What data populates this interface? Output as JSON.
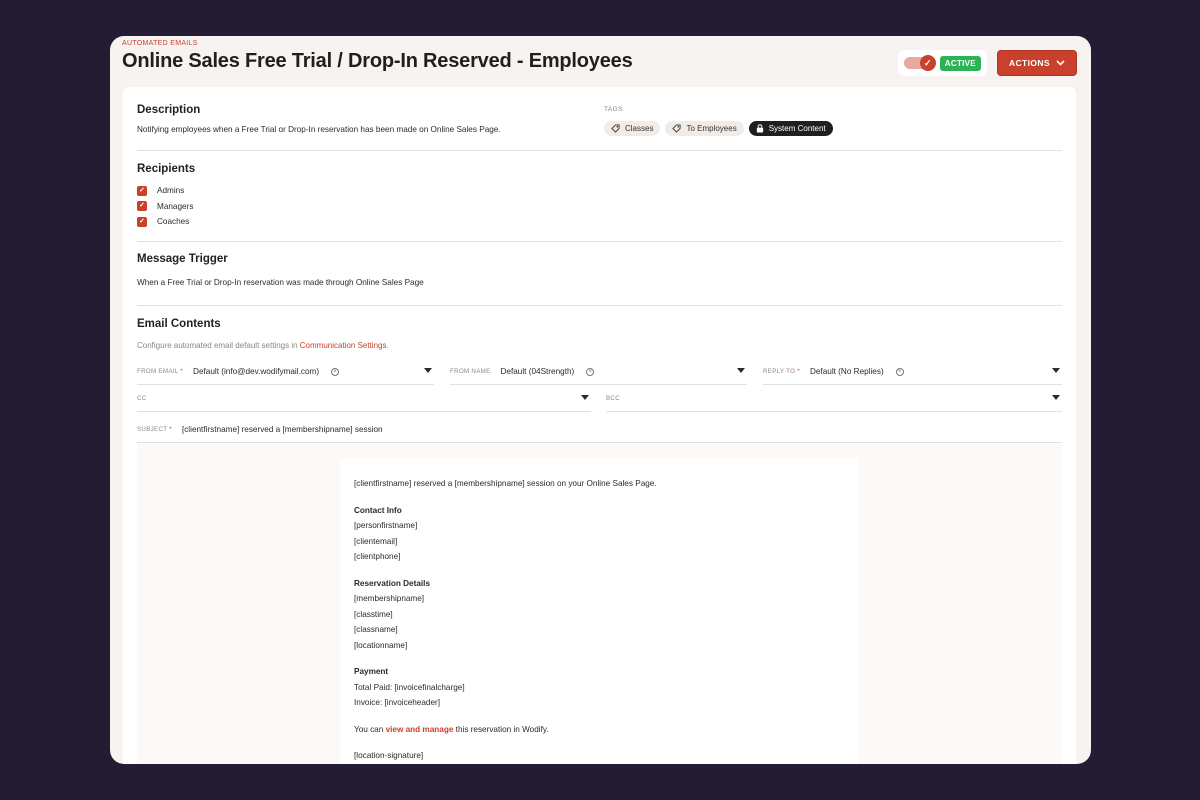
{
  "header": {
    "breadcrumb": "AUTOMATED EMAILS",
    "title": "Online Sales Free Trial / Drop-In Reserved - Employees",
    "status_badge": "ACTIVE",
    "actions_label": "ACTIONS",
    "toggle_on": true
  },
  "description": {
    "title": "Description",
    "text": "Notifying employees when a Free Trial or Drop-In reservation has been made on Online Sales Page."
  },
  "tags": {
    "label": "TAGS",
    "items": [
      {
        "label": "Classes",
        "icon": "tag-icon"
      },
      {
        "label": "To Employees",
        "icon": "tag-icon"
      },
      {
        "label": "System Content",
        "icon": "lock-icon"
      }
    ]
  },
  "recipients": {
    "title": "Recipients",
    "items": [
      {
        "label": "Admins",
        "checked": true
      },
      {
        "label": "Managers",
        "checked": true
      },
      {
        "label": "Coaches",
        "checked": true
      }
    ]
  },
  "trigger": {
    "title": "Message Trigger",
    "text": "When a Free Trial or Drop-In reservation was made through Online Sales Page"
  },
  "email_contents": {
    "title": "Email Contents",
    "hint": "Configure automated email default settings in ",
    "hint_link": "Communication Settings",
    "hint_end": ".",
    "from_email_label": "FROM EMAIL",
    "from_email_value": "Default (info@dev.wodifymail.com)",
    "from_name_label": "FROM NAME",
    "from_name_value": "Default (04Strength)",
    "reply_to_label": "REPLY TO",
    "reply_to_value": "Default (No Replies)",
    "cc_label": "CC",
    "bcc_label": "BCC",
    "subject_label": "SUBJECT",
    "subject_value": "[clientfirstname] reserved a [membershipname] session",
    "required_mark": "*"
  },
  "email_body": {
    "intro": "[clientfirstname] reserved a [membershipname] session on your Online Sales Page.",
    "contact_heading": "Contact Info",
    "contact_lines": [
      "[personfirstname]",
      "[clientemail]",
      "[clientphone]"
    ],
    "reservation_heading": "Reservation Details",
    "reservation_lines": [
      "[membershipname]",
      "[classtime]",
      "[classname]",
      "[locationname]"
    ],
    "payment_heading": "Payment",
    "payment_lines": [
      "Total Paid: [invoicefinalcharge]",
      "Invoice: [invoiceheader]"
    ],
    "manage_prefix": "You can ",
    "manage_link": "view and manage",
    "manage_suffix": " this reservation in Wodify.",
    "signature": "[location-signature]"
  },
  "colors": {
    "accent": "#c9402c",
    "active": "#2db357",
    "backdrop": "#231c33"
  }
}
